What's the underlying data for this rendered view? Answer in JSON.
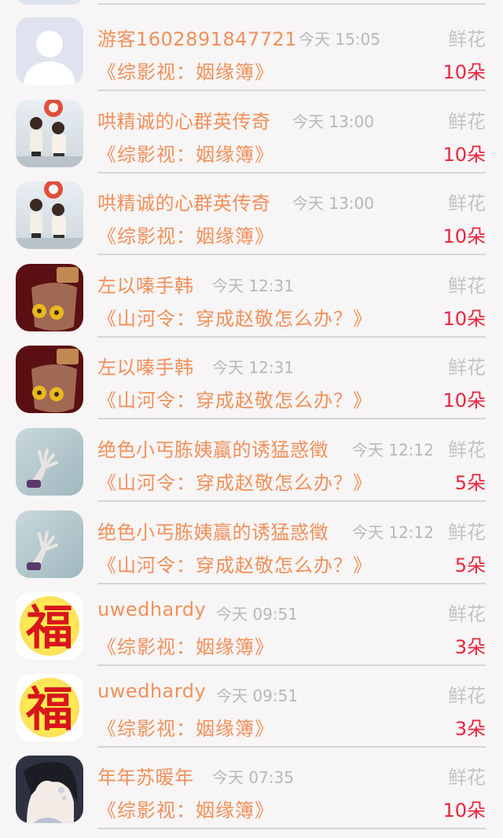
{
  "gift_label": "鲜花",
  "colors": {
    "name": "#f0905a",
    "time": "#b8b8b8",
    "gift": "#c4c4c4",
    "count": "#e8263d",
    "divider": "#d6d6d6"
  },
  "rows": [
    {
      "user": "游客1602891847721",
      "time": "今天 15:05",
      "book": "《综影视：姻缘簿》",
      "count": "10朵",
      "avatar": "default-avatar"
    },
    {
      "user": "哄精诚的心群英传奇",
      "time": "今天 13:00",
      "book": "《综影视：姻缘簿》",
      "count": "10朵",
      "avatar": "girls-photo-avatar"
    },
    {
      "user": "哄精诚的心群英传奇",
      "time": "今天 13:00",
      "book": "《综影视：姻缘簿》",
      "count": "10朵",
      "avatar": "girls-photo-avatar"
    },
    {
      "user": "左以嗪手韩",
      "time": "今天 12:31",
      "book": "《山河令：穿成赵敬怎么办？》",
      "count": "10朵",
      "avatar": "jar-avatar"
    },
    {
      "user": "左以嗪手韩",
      "time": "今天 12:31",
      "book": "《山河令：穿成赵敬怎么办？》",
      "count": "10朵",
      "avatar": "jar-avatar"
    },
    {
      "user": "绝色小丐胨姨蠃的诱猛惑徵",
      "time": "今天 12:12",
      "book": "《山河令：穿成赵敬怎么办？》",
      "count": "5朵",
      "avatar": "hand-avatar"
    },
    {
      "user": "绝色小丐胨姨蠃的诱猛惑徵",
      "time": "今天 12:12",
      "book": "《山河令：穿成赵敬怎么办？》",
      "count": "5朵",
      "avatar": "hand-avatar"
    },
    {
      "user": "uwedhardy",
      "time": "今天 09:51",
      "book": "《综影视：姻缘簿》",
      "count": "3朵",
      "avatar": "fu-avatar"
    },
    {
      "user": "uwedhardy",
      "time": "今天 09:51",
      "book": "《综影视：姻缘簿》",
      "count": "3朵",
      "avatar": "fu-avatar"
    },
    {
      "user": "年年苏暖年",
      "time": "今天 07:35",
      "book": "《综影视：姻缘簿》",
      "count": "10朵",
      "avatar": "portrait-avatar"
    }
  ],
  "fu_char": "福"
}
